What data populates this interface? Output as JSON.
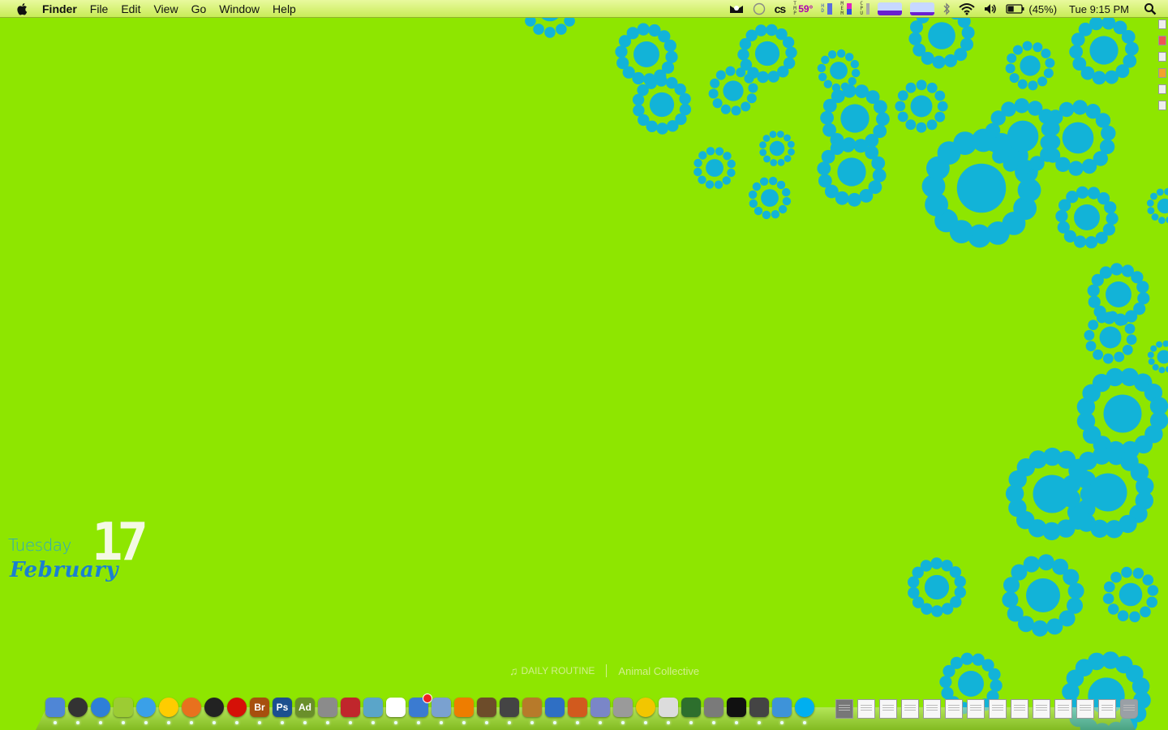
{
  "menubar": {
    "app_name": "Finder",
    "items": [
      "File",
      "Edit",
      "View",
      "Go",
      "Window",
      "Help"
    ],
    "status": {
      "temperature": "59°",
      "temp_letters": "TMP",
      "hd_letters": "HD",
      "mem_letters": "MEM",
      "cpu_letters": "CPU",
      "battery": "(45%)",
      "clock": "Tue 9:15 PM",
      "icons": [
        "menumeters-icon",
        "bubble-icon",
        "lastfm-icon",
        "bluetooth-icon",
        "wifi-icon",
        "volume-icon",
        "battery-icon",
        "spotlight-icon"
      ],
      "battery_level": 0.45,
      "net_graph_1_level": 0.35,
      "net_graph_2_level": 0.25
    }
  },
  "date_widget": {
    "weekday": "Tuesday",
    "month": "February",
    "day": "17"
  },
  "now_playing": {
    "title": "DAILY ROUTINE",
    "artist": "Animal Collective"
  },
  "colors": {
    "desktop_background": "#8ee600",
    "pattern": "#12b3d8",
    "menubar": "#d6f26e"
  },
  "dock": {
    "apps": [
      {
        "name": "finder-icon",
        "bg": "#4f86d6"
      },
      {
        "name": "dashboard-icon",
        "bg": "#333333",
        "round": true
      },
      {
        "name": "safari-icon",
        "bg": "#2e7fd8",
        "round": true
      },
      {
        "name": "wallpaper-app-icon",
        "bg": "#9ccc33"
      },
      {
        "name": "itunes-icon",
        "bg": "#3aa0e8",
        "round": true
      },
      {
        "name": "adium-icon",
        "bg": "#ffcc00",
        "round": true
      },
      {
        "name": "firefox-icon",
        "bg": "#e8711e",
        "round": true
      },
      {
        "name": "camera-app-icon",
        "bg": "#222222",
        "round": true
      },
      {
        "name": "lastfm-icon",
        "bg": "#d51007",
        "round": true
      },
      {
        "name": "adobe-bridge-icon",
        "bg": "#a74f0e",
        "label": "Br"
      },
      {
        "name": "photoshop-icon",
        "bg": "#1c4f8f",
        "label": "Ps"
      },
      {
        "name": "adobe-app-icon",
        "bg": "#6a8f2a",
        "label": "Ad"
      },
      {
        "name": "preferences-icon",
        "bg": "#8b8b8b"
      },
      {
        "name": "book-icon",
        "bg": "#c0262c"
      },
      {
        "name": "installer-icon",
        "bg": "#5aa5c9"
      },
      {
        "name": "ical-icon",
        "bg": "#ffffff"
      },
      {
        "name": "mail-stamp-icon",
        "bg": "#3b7bd1",
        "badge": true
      },
      {
        "name": "preview-icon",
        "bg": "#7aa1d0"
      },
      {
        "name": "vlc-icon",
        "bg": "#ee7d00"
      },
      {
        "name": "image-capture-icon",
        "bg": "#6d4c2a"
      },
      {
        "name": "imovie-icon",
        "bg": "#444444"
      },
      {
        "name": "garageband-icon",
        "bg": "#b77a2a"
      },
      {
        "name": "word-icon",
        "bg": "#2f6fc4"
      },
      {
        "name": "powerpoint-icon",
        "bg": "#d15a1e"
      },
      {
        "name": "entourage-icon",
        "bg": "#7a86c8"
      },
      {
        "name": "camera-icon",
        "bg": "#9a9a9a"
      },
      {
        "name": "quicktime-icon",
        "bg": "#f2c600",
        "round": true
      },
      {
        "name": "textedit-icon",
        "bg": "#dcdcdc"
      },
      {
        "name": "activity-monitor-icon",
        "bg": "#2d6f2d"
      },
      {
        "name": "script-editor-icon",
        "bg": "#7a7a7a"
      },
      {
        "name": "terminal-icon",
        "bg": "#111111"
      },
      {
        "name": "utility-icon",
        "bg": "#444444"
      },
      {
        "name": "messenger-icon",
        "bg": "#3e93d9"
      },
      {
        "name": "skype-icon",
        "bg": "#00aff0",
        "round": true
      }
    ],
    "docs": [
      "keyboard-doc-icon",
      "doc-1-icon",
      "doc-2-icon",
      "doc-3-icon",
      "doc-4-icon",
      "doc-5-icon",
      "doc-6-icon",
      "doc-7-icon",
      "doc-8-icon",
      "doc-9-icon",
      "doc-10-icon",
      "doc-11-icon",
      "doc-12-icon",
      "trash-icon"
    ]
  }
}
